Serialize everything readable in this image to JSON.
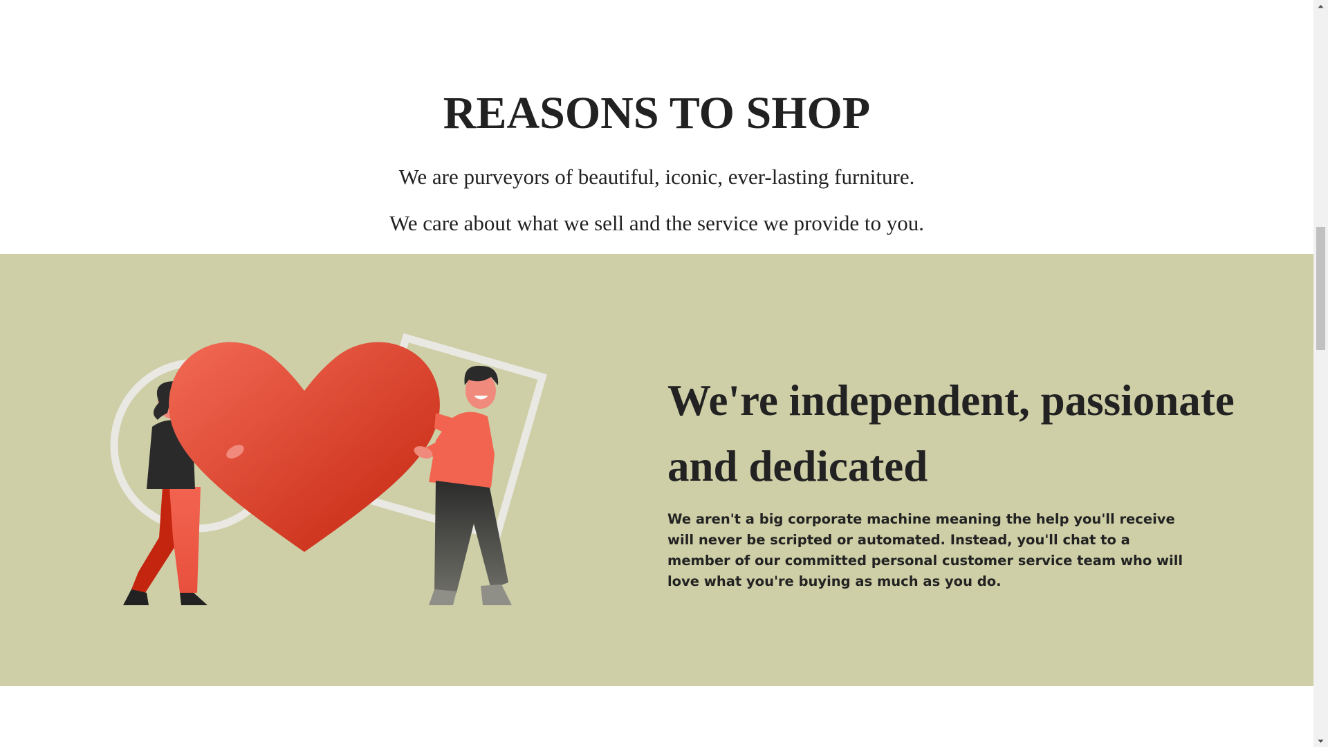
{
  "reasons": {
    "heading": "REASONS TO SHOP",
    "line1": "We are purveyors of beautiful, iconic, ever-lasting furniture.",
    "line2": "We care about what we sell and the service we provide to you."
  },
  "feature": {
    "title": "We're independent, passionate and dedicated",
    "body": "We aren't a big corporate machine meaning the help you'll receive will never be scripted or automated. Instead, you'll chat to a member of our committed personal customer service team who will love what you're buying as much as you do.",
    "illustration": "two-people-holding-heart-illustration",
    "background_color": "#cecea7"
  },
  "colors": {
    "heart": "#e8402c",
    "accent": "#f26450",
    "text": "#222222"
  }
}
